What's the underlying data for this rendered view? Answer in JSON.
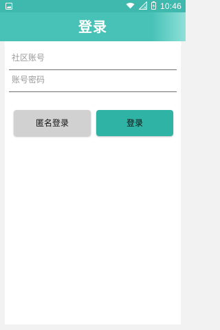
{
  "status_bar": {
    "time": "10:46",
    "icons": [
      "image-icon",
      "wifi-icon",
      "signal-icon",
      "battery-icon"
    ]
  },
  "header": {
    "title": "登录"
  },
  "form": {
    "community_account": {
      "placeholder": "社区账号",
      "value": ""
    },
    "account_password": {
      "placeholder": "账号密码",
      "value": ""
    }
  },
  "actions": {
    "anonymous_login_label": "匿名登录",
    "login_label": "登录"
  },
  "colors": {
    "primary": "#48c2b7",
    "button_primary": "#2fb3a5",
    "button_secondary": "#d1d1d1",
    "background": "#f2f2f2"
  }
}
